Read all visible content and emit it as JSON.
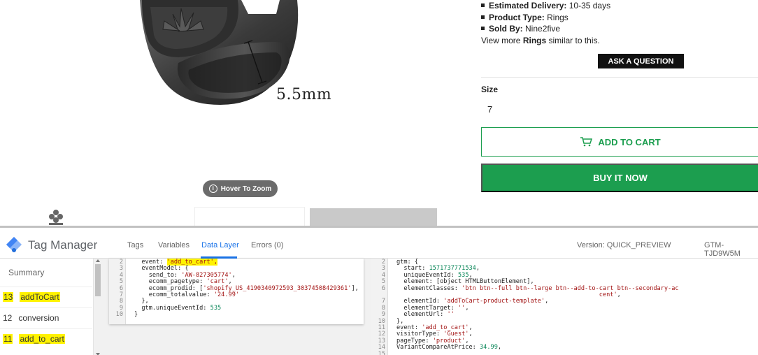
{
  "product": {
    "measure_label": "5.5mm",
    "zoom_label": "Hover To Zoom",
    "info": [
      {
        "key": "Estimated Delivery:",
        "value": "10-35 days"
      },
      {
        "key": "Product Type:",
        "value": "Rings"
      },
      {
        "key": "Sold By:",
        "value": "Nine2five"
      }
    ],
    "view_more": {
      "prefix": "View more ",
      "link": "Rings",
      "suffix": " similar to this."
    },
    "ask_label": "ASK A QUESTION",
    "size_label": "Size",
    "size_value": "7",
    "add_to_cart_label": "ADD TO CART",
    "buy_now_label": "BUY IT NOW",
    "colors": {
      "accent_green": "#1c9e4f",
      "ask_bg": "#111111"
    }
  },
  "gtm": {
    "title": "Tag Manager",
    "tabs": [
      {
        "label": "Tags"
      },
      {
        "label": "Variables"
      },
      {
        "label": "Data Layer"
      },
      {
        "label": "Errors (0)"
      }
    ],
    "active_tab": "Data Layer",
    "version": "Version: QUICK_PREVIEW",
    "container_id": "GTM-TJD9W5M",
    "sidebar": {
      "summary": "Summary",
      "items": [
        {
          "num": "13",
          "label": "addToCart",
          "highlight": true
        },
        {
          "num": "12",
          "label": "conversion",
          "highlight": false
        },
        {
          "num": "11",
          "label": "add_to_cart",
          "highlight": true
        }
      ]
    },
    "left_code": [
      {
        "n": "2",
        "parts": [
          {
            "t": "  event: "
          },
          {
            "t": "'add_to_cart',",
            "c": "hlstr str"
          }
        ]
      },
      {
        "n": "3",
        "parts": [
          {
            "t": "  eventModel: {"
          }
        ]
      },
      {
        "n": "4",
        "parts": [
          {
            "t": "    send_to: "
          },
          {
            "t": "'AW-827305774'",
            "c": "str"
          },
          {
            "t": ","
          }
        ]
      },
      {
        "n": "5",
        "parts": [
          {
            "t": "    ecomm_pagetype: "
          },
          {
            "t": "'cart'",
            "c": "str"
          },
          {
            "t": ","
          }
        ]
      },
      {
        "n": "6",
        "parts": [
          {
            "t": "    ecomm_prodid: ["
          },
          {
            "t": "'shopify_US_4190340972593_30374508429361'",
            "c": "str"
          },
          {
            "t": "],"
          }
        ]
      },
      {
        "n": "7",
        "parts": [
          {
            "t": "    ecomm_totalvalue: "
          },
          {
            "t": "'24.99'",
            "c": "str"
          }
        ]
      },
      {
        "n": "8",
        "parts": [
          {
            "t": "  },"
          }
        ]
      },
      {
        "n": "9",
        "parts": [
          {
            "t": "  gtm.uniqueEventId: "
          },
          {
            "t": "535",
            "c": "num"
          }
        ]
      },
      {
        "n": "10",
        "parts": [
          {
            "t": "}"
          }
        ]
      }
    ],
    "right_code": [
      {
        "n": "2",
        "parts": [
          {
            "t": "gtm: {"
          }
        ]
      },
      {
        "n": "3",
        "parts": [
          {
            "t": "  start: "
          },
          {
            "t": "1571737771534",
            "c": "num"
          },
          {
            "t": ","
          }
        ]
      },
      {
        "n": "4",
        "parts": [
          {
            "t": "  uniqueEventId: "
          },
          {
            "t": "535",
            "c": "num"
          },
          {
            "t": ","
          }
        ]
      },
      {
        "n": "5",
        "parts": [
          {
            "t": "  element: [object HTMLButtonElement],"
          }
        ]
      },
      {
        "n": "6",
        "parts": [
          {
            "t": "  elementClasses: "
          },
          {
            "t": "'btn btn--full btn--large btn--add-to-cart btn--secondary-ac",
            "c": "str"
          }
        ]
      },
      {
        "n": "",
        "parts": [
          {
            "t": "                                                        "
          },
          {
            "t": "cent'",
            "c": "str"
          },
          {
            "t": ","
          }
        ]
      },
      {
        "n": "7",
        "parts": [
          {
            "t": "  elementId: "
          },
          {
            "t": "'addToCart-product-template'",
            "c": "str"
          },
          {
            "t": ","
          }
        ]
      },
      {
        "n": "8",
        "parts": [
          {
            "t": "  elementTarget: "
          },
          {
            "t": "''",
            "c": "str"
          },
          {
            "t": ","
          }
        ]
      },
      {
        "n": "9",
        "parts": [
          {
            "t": "  elementUrl: "
          },
          {
            "t": "''",
            "c": "str"
          }
        ]
      },
      {
        "n": "10",
        "parts": [
          {
            "t": "},"
          }
        ]
      },
      {
        "n": "11",
        "parts": [
          {
            "t": "event: "
          },
          {
            "t": "'add_to_cart'",
            "c": "str"
          },
          {
            "t": ","
          }
        ]
      },
      {
        "n": "12",
        "parts": [
          {
            "t": "visitorType: "
          },
          {
            "t": "'Guest'",
            "c": "str"
          },
          {
            "t": ","
          }
        ]
      },
      {
        "n": "13",
        "parts": [
          {
            "t": "pageType: "
          },
          {
            "t": "'product'",
            "c": "str"
          },
          {
            "t": ","
          }
        ]
      },
      {
        "n": "14",
        "parts": [
          {
            "t": "VariantCompareAtPrice: "
          },
          {
            "t": "34.99",
            "c": "num"
          },
          {
            "t": ","
          }
        ]
      },
      {
        "n": "15",
        "parts": [
          {
            "t": ""
          }
        ]
      }
    ]
  }
}
